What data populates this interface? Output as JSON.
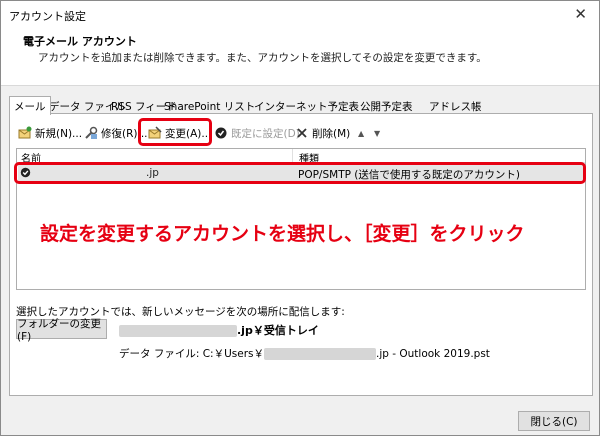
{
  "window": {
    "title": "アカウント設定",
    "close_glyph": "✕"
  },
  "header": {
    "title": "電子メール アカウント",
    "description": "アカウントを追加または削除できます。また、アカウントを選択してその設定を変更できます。"
  },
  "tabs": [
    {
      "label": "メール",
      "active": true
    },
    {
      "label": "データ ファイル"
    },
    {
      "label": "RSS フィード"
    },
    {
      "label": "SharePoint リスト"
    },
    {
      "label": "インターネット予定表"
    },
    {
      "label": "公開予定表"
    },
    {
      "label": "アドレス帳"
    }
  ],
  "toolbar": {
    "new_label": "新規(N)...",
    "repair_label": "修復(R)...",
    "change_label": "変更(A)...",
    "set_default_label": "既定に設定(D)",
    "delete_label": "削除(M)",
    "up_glyph": "▲",
    "down_glyph": "▼"
  },
  "icons": {
    "new": "new-account-icon",
    "repair": "repair-icon",
    "change": "change-icon",
    "set_default": "check-circle-icon",
    "delete": "delete-x-icon",
    "move_up": "arrow-up-icon",
    "move_down": "arrow-down-icon"
  },
  "list": {
    "col_name": "名前",
    "col_type": "種類",
    "rows": [
      {
        "name": ".jp",
        "type": "POP/SMTP (送信で使用する既定のアカウント)",
        "default": true
      }
    ]
  },
  "annotation": "設定を変更するアカウントを選択し、［変更］をクリック",
  "delivery": {
    "label": "選択したアカウントでは、新しいメッセージを次の場所に配信します:",
    "folder_button": "フォルダーの変更(F)",
    "inbox_suffix": ".jp￥受信トレイ",
    "datafile_prefix": "データ ファイル: C:￥Users￥",
    "datafile_suffix": ".jp - Outlook 2019.pst"
  },
  "footer": {
    "close_button": "閉じる(C)"
  },
  "colors": {
    "highlight": "#e60012",
    "selected_row": "#e5e5e5"
  }
}
